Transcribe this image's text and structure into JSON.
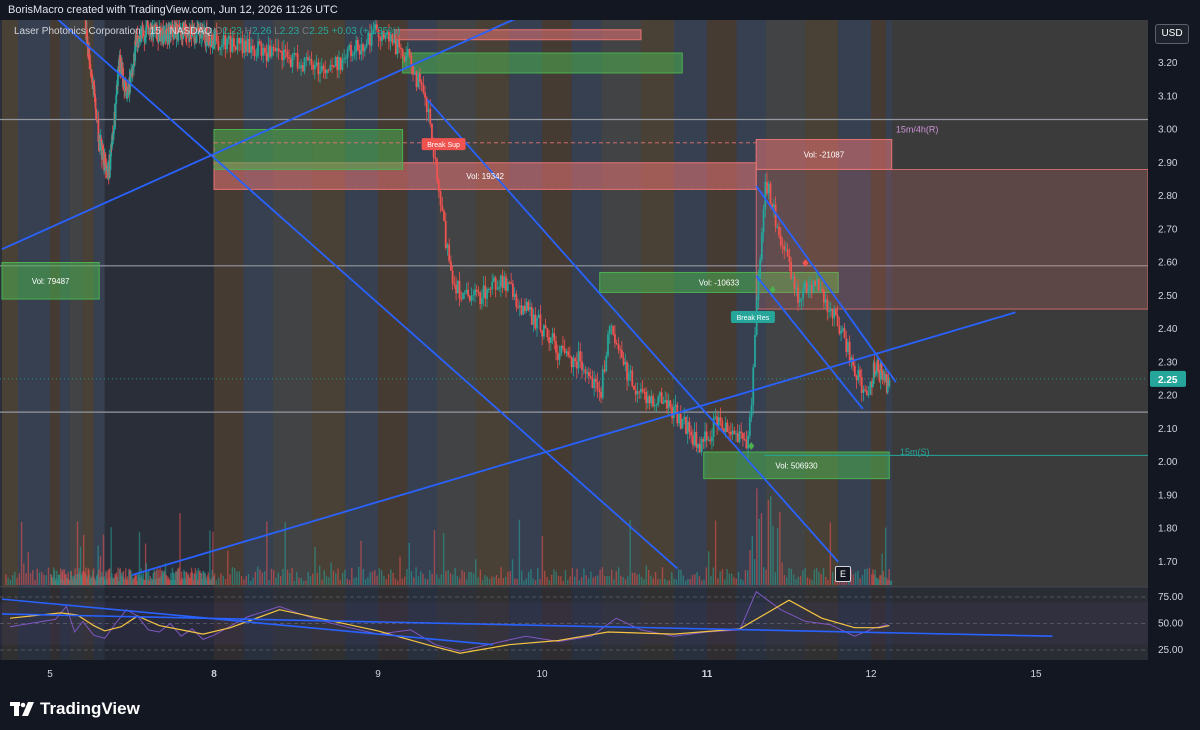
{
  "header": {
    "credit": "BorisMacro created with TradingView.com, Jun 12, 2026 11:26 UTC"
  },
  "legend": {
    "symbol": "Laser Photonics Corporation",
    "interval": "15",
    "exchange": "NASDAQ",
    "o_label": "O",
    "o_value": "2.23",
    "h_label": "H",
    "h_value": "2.26",
    "l_label": "L",
    "l_value": "2.23",
    "c_label": "C",
    "c_value": "2.25",
    "change": "+0.03 (+1.35%)"
  },
  "currency_button": "USD",
  "footer": {
    "brand": "TradingView"
  },
  "colors": {
    "background": "#131722",
    "up": "#26a69a",
    "down": "#ef5350",
    "trendline": "#2962ff",
    "rsi": "#7e57c2",
    "rsi_ma": "#f5c542",
    "price_marker": "#26a69a"
  },
  "chart_data": {
    "type": "candlestick",
    "symbol": "Laser Photonics Corporation",
    "interval": "15",
    "exchange": "NASDAQ",
    "x_ticks": [
      {
        "label": "5",
        "day": 5
      },
      {
        "label": "8",
        "day": 8
      },
      {
        "label": "9",
        "day": 9
      },
      {
        "label": "10",
        "day": 10
      },
      {
        "label": "11",
        "day": 11
      },
      {
        "label": "12",
        "day": 12
      },
      {
        "label": "15",
        "day": 15
      }
    ],
    "y_ticks": [
      3.2,
      3.1,
      3.0,
      2.9,
      2.8,
      2.7,
      2.6,
      2.5,
      2.4,
      2.3,
      2.2,
      2.1,
      2.0,
      1.9,
      1.8,
      1.7
    ],
    "ylim": [
      1.66,
      3.3
    ],
    "last_price": "2.25",
    "price_path": [
      [
        5.05,
        3.9
      ],
      [
        5.35,
        3.6
      ],
      [
        5.6,
        3.35
      ],
      [
        5.75,
        3.15
      ],
      [
        5.9,
        2.95
      ],
      [
        6.05,
        2.87
      ],
      [
        6.15,
        3.0
      ],
      [
        6.25,
        3.2
      ],
      [
        6.4,
        3.1
      ],
      [
        6.55,
        3.25
      ],
      [
        6.75,
        3.3
      ],
      [
        7.0,
        3.28
      ],
      [
        7.4,
        3.3
      ],
      [
        8.0,
        3.27
      ],
      [
        8.4,
        3.22
      ],
      [
        8.7,
        3.18
      ],
      [
        9.0,
        3.3
      ],
      [
        9.2,
        3.2
      ],
      [
        9.3,
        3.05
      ],
      [
        9.38,
        2.75
      ],
      [
        9.45,
        2.55
      ],
      [
        9.55,
        2.48
      ],
      [
        9.75,
        2.55
      ],
      [
        9.85,
        2.48
      ],
      [
        10.0,
        2.4
      ],
      [
        10.1,
        2.33
      ],
      [
        10.25,
        2.3
      ],
      [
        10.35,
        2.2
      ],
      [
        10.4,
        2.4
      ],
      [
        10.5,
        2.28
      ],
      [
        10.6,
        2.2
      ],
      [
        10.75,
        2.18
      ],
      [
        10.85,
        2.12
      ],
      [
        10.95,
        2.04
      ],
      [
        11.05,
        2.12
      ],
      [
        11.15,
        2.1
      ],
      [
        11.25,
        2.06
      ],
      [
        11.3,
        2.5
      ],
      [
        11.35,
        2.85
      ],
      [
        11.45,
        2.65
      ],
      [
        11.55,
        2.5
      ],
      [
        11.65,
        2.55
      ],
      [
        11.75,
        2.45
      ],
      [
        11.85,
        2.35
      ],
      [
        11.95,
        2.2
      ],
      [
        12.05,
        2.3
      ],
      [
        12.15,
        2.25
      ],
      [
        12.2,
        2.23
      ],
      [
        12.22,
        2.25
      ]
    ],
    "horizontal_lines": [
      3.03,
      2.59,
      2.15
    ],
    "zones": [
      {
        "label": "Vol: 79487",
        "type": "demand",
        "day_from": 4.7,
        "day_to": 5.9,
        "high": 2.6,
        "low": 2.49
      },
      {
        "label": "Vol: 19342",
        "type": "supply",
        "day_from": 8.0,
        "day_to": 11.3,
        "high": 2.9,
        "low": 2.82
      },
      {
        "label": "Vol: -10633",
        "type": "demand",
        "day_from": 10.35,
        "day_to": 11.8,
        "high": 2.57,
        "low": 2.51
      },
      {
        "label": "Vol: -21087",
        "type": "supply",
        "day_from": 11.3,
        "day_to": 12.25,
        "high": 2.97,
        "low": 2.88
      },
      {
        "label": "Vol: 506930",
        "type": "demand",
        "day_from": 10.98,
        "day_to": 12.22,
        "high": 2.03,
        "low": 1.95
      },
      {
        "label": "",
        "type": "supply",
        "day_from": 9.1,
        "day_to": 10.6,
        "high": 3.3,
        "low": 3.27
      },
      {
        "label": "",
        "type": "demand",
        "day_from": 9.15,
        "day_to": 10.85,
        "high": 3.23,
        "low": 3.17
      },
      {
        "label": "",
        "type": "demand",
        "day_from": 8.0,
        "day_to": 9.15,
        "high": 3.0,
        "low": 2.88
      }
    ],
    "annotations": [
      {
        "text": "15m/4h(R)",
        "day": 12.3,
        "price": 3.0,
        "color": "#ce93d8"
      },
      {
        "text": "15m(S)",
        "day": 12.35,
        "price": 2.03,
        "color": "#26a69a"
      },
      {
        "text": "Break Sup",
        "day": 9.4,
        "price": 2.95,
        "color": "#ef5350"
      },
      {
        "text": "Break Res",
        "day": 11.28,
        "price": 2.43,
        "color": "#26a69a"
      }
    ],
    "trendlines": [
      {
        "from": [
          4.7,
          3.48
        ],
        "to": [
          10.82,
          1.68
        ]
      },
      {
        "from": [
          4.7,
          2.64
        ],
        "to": [
          10.05,
          3.38
        ]
      },
      {
        "from": [
          6.5,
          1.66
        ],
        "to": [
          14.5,
          2.45
        ]
      },
      {
        "from": [
          9.3,
          3.09
        ],
        "to": [
          11.8,
          1.7
        ]
      },
      {
        "from": [
          11.3,
          2.83
        ],
        "to": [
          12.3,
          2.24
        ]
      },
      {
        "from": [
          11.3,
          2.56
        ],
        "to": [
          11.95,
          2.16
        ]
      }
    ],
    "rsi": {
      "ticks": [
        75.0,
        50.0,
        25.0
      ],
      "ylim": [
        18,
        85
      ],
      "rsi_path": [
        [
          4.75,
          47
        ],
        [
          5.1,
          54
        ],
        [
          5.3,
          66
        ],
        [
          5.45,
          42
        ],
        [
          5.6,
          52
        ],
        [
          5.8,
          39
        ],
        [
          6.0,
          36
        ],
        [
          6.2,
          50
        ],
        [
          6.4,
          63
        ],
        [
          6.6,
          57
        ],
        [
          6.8,
          44
        ],
        [
          7.0,
          42
        ],
        [
          7.2,
          50
        ],
        [
          7.4,
          38
        ],
        [
          7.6,
          45
        ],
        [
          7.8,
          35
        ],
        [
          8.0,
          39
        ],
        [
          8.2,
          56
        ],
        [
          8.4,
          66
        ],
        [
          8.6,
          55
        ],
        [
          8.8,
          47
        ],
        [
          9.0,
          40
        ],
        [
          9.2,
          44
        ],
        [
          9.35,
          30
        ],
        [
          9.5,
          24
        ],
        [
          9.7,
          31
        ],
        [
          9.9,
          38
        ],
        [
          10.1,
          33
        ],
        [
          10.3,
          38
        ],
        [
          10.45,
          55
        ],
        [
          10.6,
          44
        ],
        [
          10.8,
          38
        ],
        [
          11.0,
          42
        ],
        [
          11.2,
          44
        ],
        [
          11.3,
          80
        ],
        [
          11.45,
          63
        ],
        [
          11.6,
          52
        ],
        [
          11.75,
          49
        ],
        [
          11.9,
          38
        ],
        [
          12.05,
          46
        ],
        [
          12.2,
          49
        ]
      ],
      "ma_path": [
        [
          4.75,
          55
        ],
        [
          5.2,
          60
        ],
        [
          5.5,
          58
        ],
        [
          5.8,
          48
        ],
        [
          6.0,
          43
        ],
        [
          6.3,
          47
        ],
        [
          6.6,
          57
        ],
        [
          7.0,
          48
        ],
        [
          7.5,
          43
        ],
        [
          7.8,
          40
        ],
        [
          8.1,
          46
        ],
        [
          8.4,
          63
        ],
        [
          8.7,
          53
        ],
        [
          9.0,
          43
        ],
        [
          9.3,
          30
        ],
        [
          9.5,
          22
        ],
        [
          9.8,
          30
        ],
        [
          10.1,
          34
        ],
        [
          10.4,
          42
        ],
        [
          10.8,
          40
        ],
        [
          11.2,
          45
        ],
        [
          11.5,
          72
        ],
        [
          11.7,
          55
        ],
        [
          11.9,
          46
        ],
        [
          12.1,
          46
        ],
        [
          12.22,
          48
        ]
      ],
      "trendlines": [
        {
          "from": [
            4.7,
            73
          ],
          "to": [
            9.7,
            30
          ]
        },
        {
          "from": [
            4.7,
            59
          ],
          "to": [
            15.4,
            38
          ]
        }
      ]
    }
  }
}
